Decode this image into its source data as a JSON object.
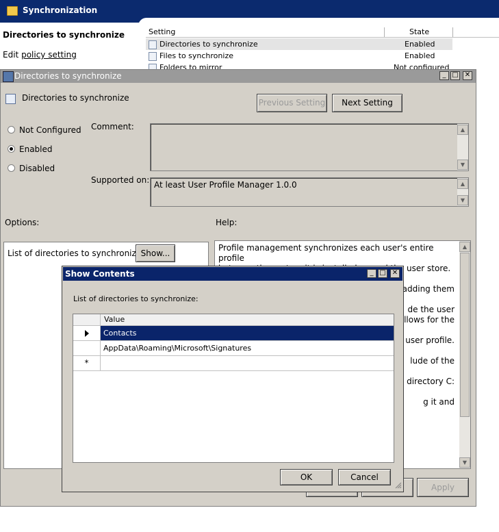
{
  "background": {
    "title": "Synchronization",
    "left_panel": {
      "heading": "Directories to synchronize",
      "edit_prefix": "Edit",
      "edit_link": "policy setting"
    },
    "grid": {
      "columns": [
        "Setting",
        "State"
      ],
      "rows": [
        {
          "setting": "Directories to synchronize",
          "state": "Enabled"
        },
        {
          "setting": "Files to synchronize",
          "state": "Enabled"
        },
        {
          "setting": "Folders to mirror",
          "state": "Not configured"
        }
      ]
    }
  },
  "dialog": {
    "title": "Directories to synchronize",
    "setting_name": "Directories to synchronize",
    "previous_label": "Previous Setting",
    "next_label": "Next Setting",
    "radio": {
      "not_configured": "Not Configured",
      "enabled": "Enabled",
      "disabled": "Disabled",
      "selected": "enabled"
    },
    "comment_label": "Comment:",
    "supported_label": "Supported on:",
    "supported_value": "At least User Profile Manager 1.0.0",
    "options_label": "Options:",
    "help_label": "Help:",
    "list_label": "List of directories to synchronize:",
    "show_label": "Show...",
    "help_lines": [
      "Profile management synchronizes each user's entire profile",
      "between the system it is installed on and the user store. It is not",
      "y adding them",
      "",
      "de the user",
      "allows for the",
      "",
      "e user profile.",
      "",
      "lude of the",
      "",
      "directory C:",
      "",
      "g it and"
    ],
    "apply_label": "Apply"
  },
  "show_contents": {
    "title": "Show Contents",
    "label": "List of directories to synchronize:",
    "column": "Value",
    "rows": [
      "Contacts",
      "AppData\\Roaming\\Microsoft\\Signatures",
      ""
    ],
    "new_row_marker": "*",
    "ok_label": "OK",
    "cancel_label": "Cancel"
  }
}
